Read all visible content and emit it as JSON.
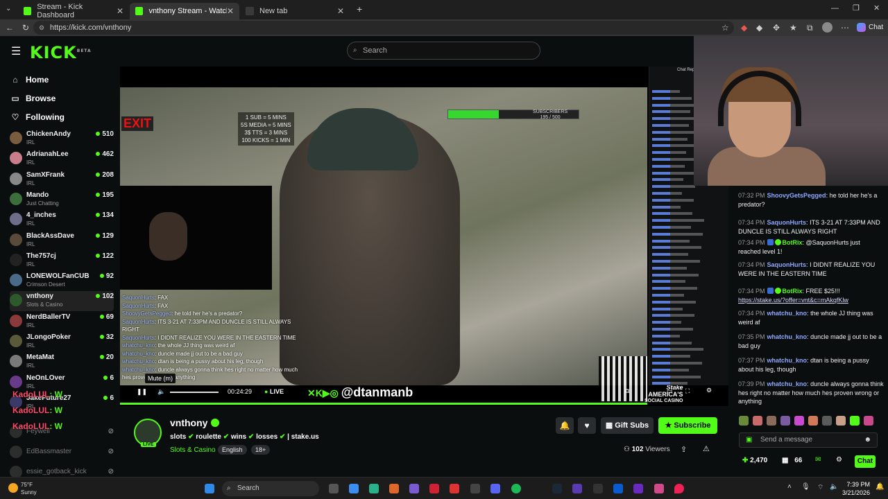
{
  "browser": {
    "tabs": [
      {
        "label": "Stream - Kick Dashboard",
        "active": false
      },
      {
        "label": "vnthony Stream - Watch Live",
        "active": true
      },
      {
        "label": "New tab",
        "active": false
      }
    ],
    "url": "https://kick.com/vnthony"
  },
  "header": {
    "logo": "KICK",
    "logo_beta": "BETA",
    "search_placeholder": "Search"
  },
  "sidebar": {
    "nav": [
      {
        "label": "Home",
        "icon": "home-icon"
      },
      {
        "label": "Browse",
        "icon": "browse-icon"
      },
      {
        "label": "Following",
        "icon": "heart-icon"
      }
    ],
    "channels": [
      {
        "name": "ChickenAndy",
        "category": "IRL",
        "viewers": "510",
        "color": "#7a5c3e"
      },
      {
        "name": "AdrianahLee",
        "category": "IRL",
        "viewers": "462",
        "color": "#c97d8a"
      },
      {
        "name": "SamXFrank",
        "category": "IRL",
        "viewers": "208",
        "color": "#888888"
      },
      {
        "name": "Mando",
        "category": "Just Chatting",
        "viewers": "195",
        "color": "#3c6e3c"
      },
      {
        "name": "4_inches",
        "category": "IRL",
        "viewers": "134",
        "color": "#6e6e8a"
      },
      {
        "name": "BlackAssDave",
        "category": "IRL",
        "viewers": "129",
        "color": "#5a4a3a"
      },
      {
        "name": "The757cj",
        "category": "IRL",
        "viewers": "122",
        "color": "#222222"
      },
      {
        "name": "LONEWOLFanCUB",
        "category": "Crimson Desert",
        "viewers": "92",
        "color": "#4a6a8a"
      },
      {
        "name": "vnthony",
        "category": "Slots & Casino",
        "viewers": "102",
        "color": "#2c5a2c"
      },
      {
        "name": "NerdBallerTV",
        "category": "IRL",
        "viewers": "69",
        "color": "#8a3a3a"
      },
      {
        "name": "JLongoPoker",
        "category": "IRL",
        "viewers": "32",
        "color": "#5a5a3a"
      },
      {
        "name": "MetaMat",
        "category": "IRL",
        "viewers": "20",
        "color": "#7a7a7a"
      },
      {
        "name": "NeOnLOver",
        "category": "IRL",
        "viewers": "6",
        "color": "#6a3a8a"
      },
      {
        "name": "JakeFuture27",
        "category": "IRL",
        "viewers": "6",
        "color": "#3a3a6a"
      }
    ],
    "offline": [
      {
        "name": "Feywell"
      },
      {
        "name": "EdBassmaster"
      },
      {
        "name": "essie_gotback_kick"
      }
    ],
    "spam_user": "KadoLUL",
    "spam_text": ": W"
  },
  "video": {
    "exit_sign": "EXIT",
    "sub_rules": [
      "1 SUB = 5 MINS",
      "5S MEDIA = 5 MINS",
      "3$ TTS = 3 MINS",
      "100 KICKS = 1 MIN"
    ],
    "goal_label": "SUBSCRIBERS",
    "goal_value": "195 / 500",
    "goal_fraction": 0.39,
    "handle": "@dtanmanb",
    "stake_line1": "AMERICA'S",
    "stake_line2": "SOCIAL CASINO",
    "stake_brand": "Stake",
    "time": "00:24:29",
    "live": "LIVE",
    "tooltip": "Mute (m)",
    "replay_label": "Chat Replay",
    "overlay_chat": [
      {
        "user": "SaquonHurts",
        "text": ": FAX"
      },
      {
        "user": "SaquonHurts",
        "text": ": FAX"
      },
      {
        "user": "ShoovyGetsPegged",
        "text": ": he told her he's a predator?"
      },
      {
        "user": "SaquonHurts",
        "text": ": ITS 3-21 AT 7:33PM AND DUNCLE IS STILL ALWAYS RIGHT"
      },
      {
        "user": "SaquonHurts",
        "text": ": I DIDNT REALIZE YOU WERE IN THE EASTERN TIME"
      },
      {
        "user": "whatchu_kno",
        "text": ": the whole JJ thing was weird af"
      },
      {
        "user": "whatchu_kno",
        "text": ": duncle made jj out to be a bad guy"
      },
      {
        "user": "whatchu_kno",
        "text": ": dtan is being a pussy about his leg, though"
      },
      {
        "user": "whatchu_kno",
        "text": ": duncle always gonna think hes right no matter how much hes proven wrong or anything"
      }
    ]
  },
  "stream": {
    "name": "vnthony",
    "title_parts": [
      "slots",
      "roulette",
      "wins",
      "losses",
      "| stake.us"
    ],
    "category": "Slots & Casino",
    "tags": [
      "English",
      "18+"
    ],
    "live_badge": "LIVE",
    "gift_label": "Gift Subs",
    "subscribe_label": "Subscribe",
    "viewers_count": "102",
    "viewers_label": "Viewers"
  },
  "chat": {
    "messages": [
      {
        "time": "07:32 PM",
        "user": "ShoovyGetsPegged",
        "color": "#8fa8ff",
        "badges": 0,
        "text": "he told her he's a predator?"
      },
      {
        "time": "07:34 PM",
        "user": "SaquonHurts",
        "color": "#8fa8ff",
        "badges": 0,
        "text": "ITS 3-21 AT 7:33PM AND DUNCLE IS STILL ALWAYS RIGHT"
      },
      {
        "time": "07:34 PM",
        "user": "BotRix",
        "color": "#53fc18",
        "badges": 2,
        "text": "@SaquonHurts just reached level 1!"
      },
      {
        "time": "07:34 PM",
        "user": "SaquonHurts",
        "color": "#8fa8ff",
        "badges": 0,
        "text": "I DIDNT REALIZE YOU WERE IN THE EASTERN TIME"
      },
      {
        "time": "07:34 PM",
        "user": "BotRix",
        "color": "#53fc18",
        "badges": 2,
        "text": "FREE $25!!!",
        "link": "https://stake.us/?offer=vnt&c=mAkqfKlw"
      },
      {
        "time": "07:34 PM",
        "user": "whatchu_kno",
        "color": "#8fa8ff",
        "badges": 0,
        "text": "the whole JJ thing was weird af"
      },
      {
        "time": "07:35 PM",
        "user": "whatchu_kno",
        "color": "#8fa8ff",
        "badges": 0,
        "text": "duncle made jj out to be a bad guy"
      },
      {
        "time": "07:37 PM",
        "user": "whatchu_kno",
        "color": "#8fa8ff",
        "badges": 0,
        "text": "dtan is being a pussy about his leg, though"
      },
      {
        "time": "07:39 PM",
        "user": "whatchu_kno",
        "color": "#8fa8ff",
        "badges": 0,
        "text": "duncle always gonna think hes right no matter how much hes proven wrong or anything"
      }
    ],
    "send_placeholder": "Send a message",
    "points": "2,470",
    "gifts": "66",
    "chat_button": "Chat"
  },
  "taskbar": {
    "temp": "75°F",
    "weather": "Sunny",
    "search": "Search",
    "time": "7:39 PM",
    "date": "3/21/2026"
  }
}
